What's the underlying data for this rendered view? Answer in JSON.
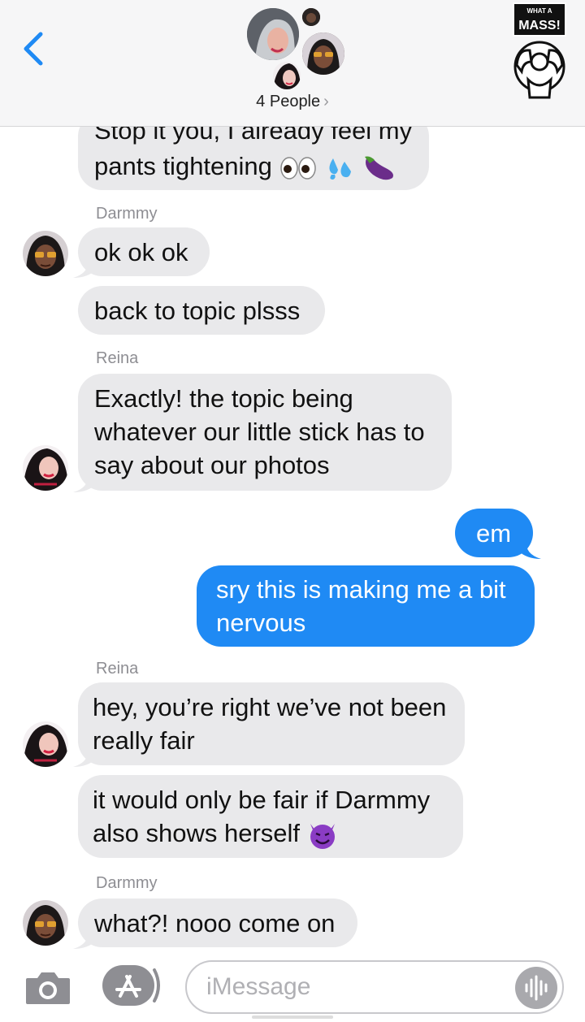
{
  "header": {
    "people_label": "4 People",
    "people_chevron": "›",
    "back_icon": "chevron-left-icon",
    "logo_text_top": "WHAT A",
    "logo_text_main": "MASS!"
  },
  "messages": [
    {
      "type": "incoming",
      "line1": "Stop it you, I already feel my",
      "line2": "pants tightening",
      "emoji": [
        "eyes",
        "sweat-droplets",
        "eggplant"
      ]
    },
    {
      "type": "sender",
      "name": "Darmmy"
    },
    {
      "type": "incoming",
      "text": "ok ok ok"
    },
    {
      "type": "incoming",
      "text": "back to topic plsss"
    },
    {
      "type": "sender",
      "name": "Reina"
    },
    {
      "type": "incoming",
      "line1": "Exactly! the topic being",
      "line2": "whatever our little stick has to",
      "line3": "say about our photos"
    },
    {
      "type": "outgoing",
      "text": "em"
    },
    {
      "type": "outgoing",
      "line1": "sry this is making me a bit",
      "line2": "nervous"
    },
    {
      "type": "sender",
      "name": "Reina"
    },
    {
      "type": "incoming",
      "line1": "hey, you’re right we’ve not been",
      "line2": "really fair"
    },
    {
      "type": "incoming",
      "line1": "it would only be fair if Darmmy",
      "line2": "also shows herself",
      "emoji": [
        "smiling-imp"
      ]
    },
    {
      "type": "sender",
      "name": "Darmmy"
    },
    {
      "type": "incoming",
      "text": "what?! nooo come on"
    }
  ],
  "input": {
    "placeholder": "iMessage",
    "camera_icon": "camera-icon",
    "apps_icon": "app-store-icon",
    "audio_icon": "audio-waveform-icon"
  },
  "colors": {
    "incoming_bubble": "#e9e9eb",
    "outgoing_bubble": "#1f8af4",
    "accent": "#1f8af4"
  }
}
